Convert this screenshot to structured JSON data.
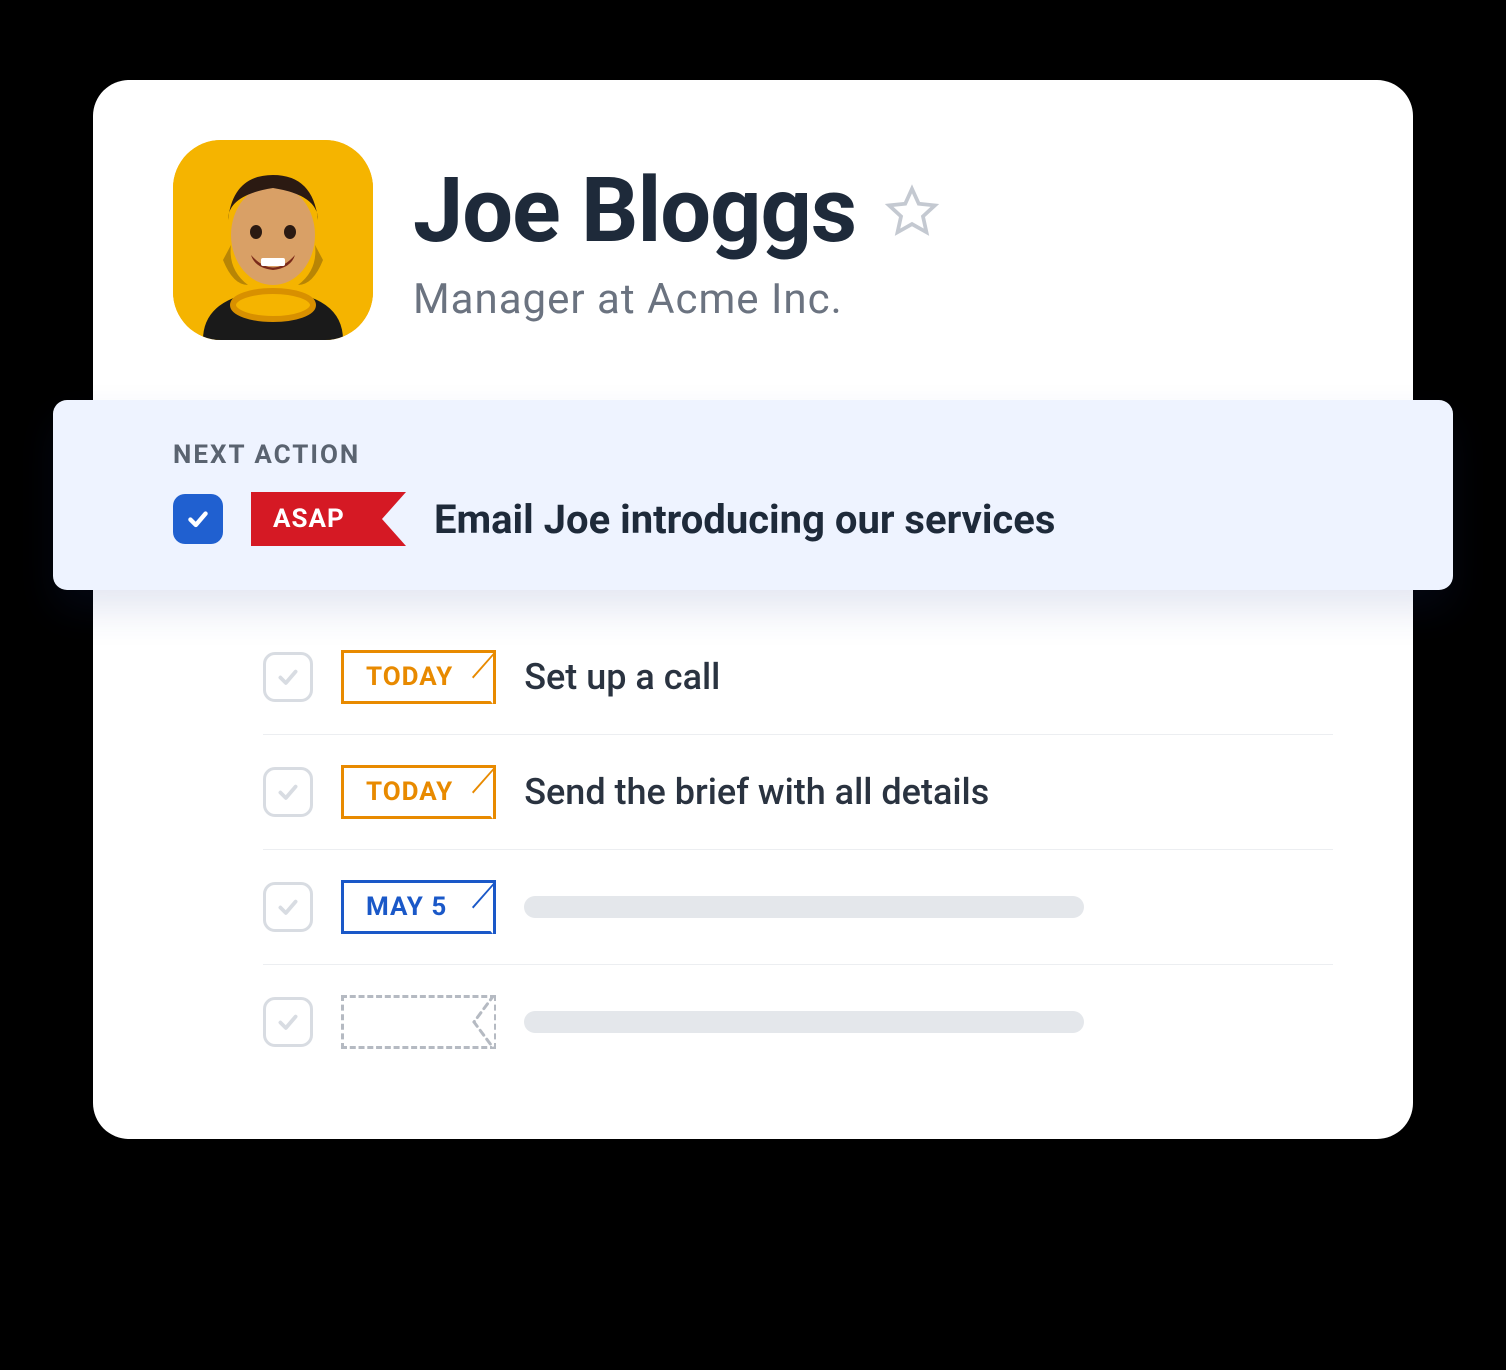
{
  "contact": {
    "name": "Joe Bloggs",
    "subtitle": "Manager at Acme Inc."
  },
  "next_action": {
    "label": "NEXT ACTION",
    "flag": "ASAP",
    "title": "Email Joe introducing our services"
  },
  "tasks": [
    {
      "flag": "TODAY",
      "flag_style": "outline-orange",
      "title": "Set up a call"
    },
    {
      "flag": "TODAY",
      "flag_style": "outline-orange",
      "title": "Send the brief with all details"
    },
    {
      "flag": "MAY 5",
      "flag_style": "outline-blue",
      "title": ""
    },
    {
      "flag": "",
      "flag_style": "outline-dashed",
      "title": ""
    }
  ]
}
